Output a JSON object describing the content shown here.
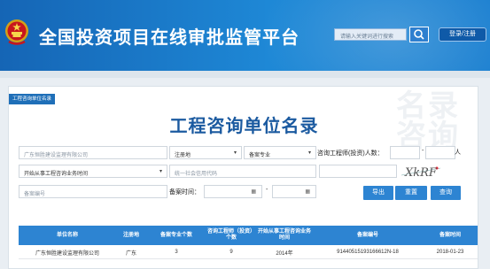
{
  "header": {
    "title": "全国投资项目在线审批监管平台",
    "search_placeholder": "请输入关键词进行搜索",
    "login_label": "登录/注册"
  },
  "panel": {
    "tag": "工程咨询单位名录",
    "heading": "工程咨询单位名录",
    "watermark": "名录咨询"
  },
  "filters": {
    "company_name": "广东恒胜建设监理有限公司",
    "region": "注册地",
    "specialty": "备案专业",
    "engineer_count_label": "咨询工程师(投资)人数：",
    "range_dash": "-",
    "person_unit": "人",
    "start_time": "开始从事工程咨询业务时间",
    "credit_code_placeholder": "统一社会信用代码",
    "record_no_placeholder": "备案编号",
    "record_time_label": "备案时间：",
    "captcha_text": "XkRF"
  },
  "buttons": {
    "export": "导出",
    "reset": "重置",
    "query": "查询"
  },
  "table": {
    "headers": [
      "单位名称",
      "注册地",
      "备案专业个数",
      "咨询工程师（投资）个数",
      "开始从事工程咨询业务时间",
      "备案编号",
      "备案时间"
    ],
    "rows": [
      [
        "广东恒胜建设监理有限公司",
        "广东",
        "3",
        "9",
        "2014年",
        "91440515193166612N-18",
        "2018-01-23"
      ]
    ]
  },
  "colors": {
    "header_blue": "#1e88d6",
    "button_blue": "#2d84d2",
    "heading_blue": "#1b5aa0"
  }
}
